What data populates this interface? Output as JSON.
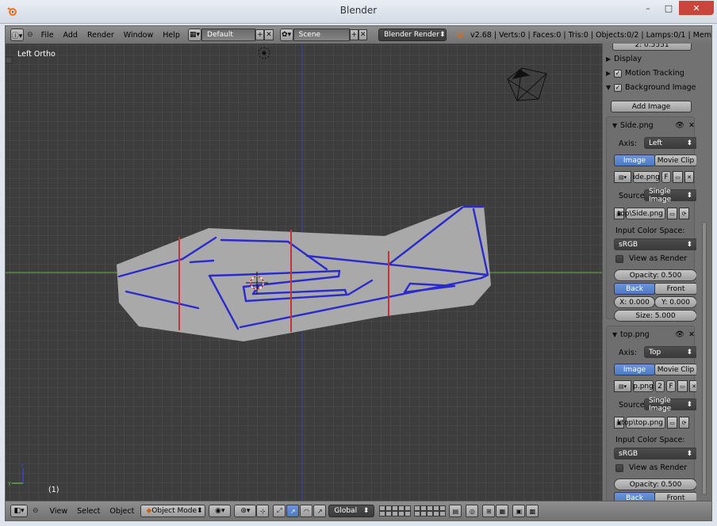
{
  "window": {
    "title": "Blender",
    "controls": {
      "minimize": "–",
      "maximize": "□",
      "close": "✕"
    }
  },
  "info_header": {
    "menus": [
      "File",
      "Add",
      "Render",
      "Window",
      "Help"
    ],
    "screen_layout": "Default",
    "scene": "Scene",
    "render_engine": "Blender Render",
    "stats": "v2.68 | Verts:0 | Faces:0 | Tris:0 | Objects:0/2 | Lamps:0/1 | Mem"
  },
  "viewport": {
    "view_label": "Left Ortho",
    "frame_label": "(1)",
    "axis_colors": {
      "horizontal": "#5fae3f",
      "vertical": "#3a44c8",
      "sketch": "#2a2acf",
      "section": "#c83232"
    }
  },
  "properties": {
    "partial_value": "2: 0.5551",
    "display_label": "Display",
    "motion_tracking_label": "Motion Tracking",
    "background_images_label": "Background Images",
    "add_image_label": "Add Image",
    "images": [
      {
        "name": "Side.png",
        "axis_label": "Axis:",
        "axis_value": "Left",
        "image_tab": "Image",
        "movie_clip_tab": "Movie Clip",
        "file_short": "ide.png",
        "file_flag": "F",
        "source_label": "Source",
        "source_value": "Single Image",
        "path": "top\\Side.png",
        "color_space_label": "Input Color Space:",
        "color_space": "sRGB",
        "view_as_render": "View as Render",
        "opacity": "Opacity: 0.500",
        "back": "Back",
        "front": "Front",
        "x": "X: 0.000",
        "y": "Y: 0.000",
        "size": "Size: 5.000"
      },
      {
        "name": "top.png",
        "axis_label": "Axis:",
        "axis_value": "Top",
        "image_tab": "Image",
        "movie_clip_tab": "Movie Clip",
        "file_short": "p.png",
        "file_users": "2",
        "file_flag": "F",
        "source_label": "Source",
        "source_value": "Single Image",
        "path": "ktop\\top.png",
        "color_space_label": "Input Color Space:",
        "color_space": "sRGB",
        "view_as_render": "View as Render",
        "opacity": "Opacity: 0.500",
        "back": "Back",
        "front": "Front"
      }
    ]
  },
  "bottom_header": {
    "menus": [
      "View",
      "Select",
      "Object"
    ],
    "mode": "Object Mode",
    "orientation": "Global"
  }
}
